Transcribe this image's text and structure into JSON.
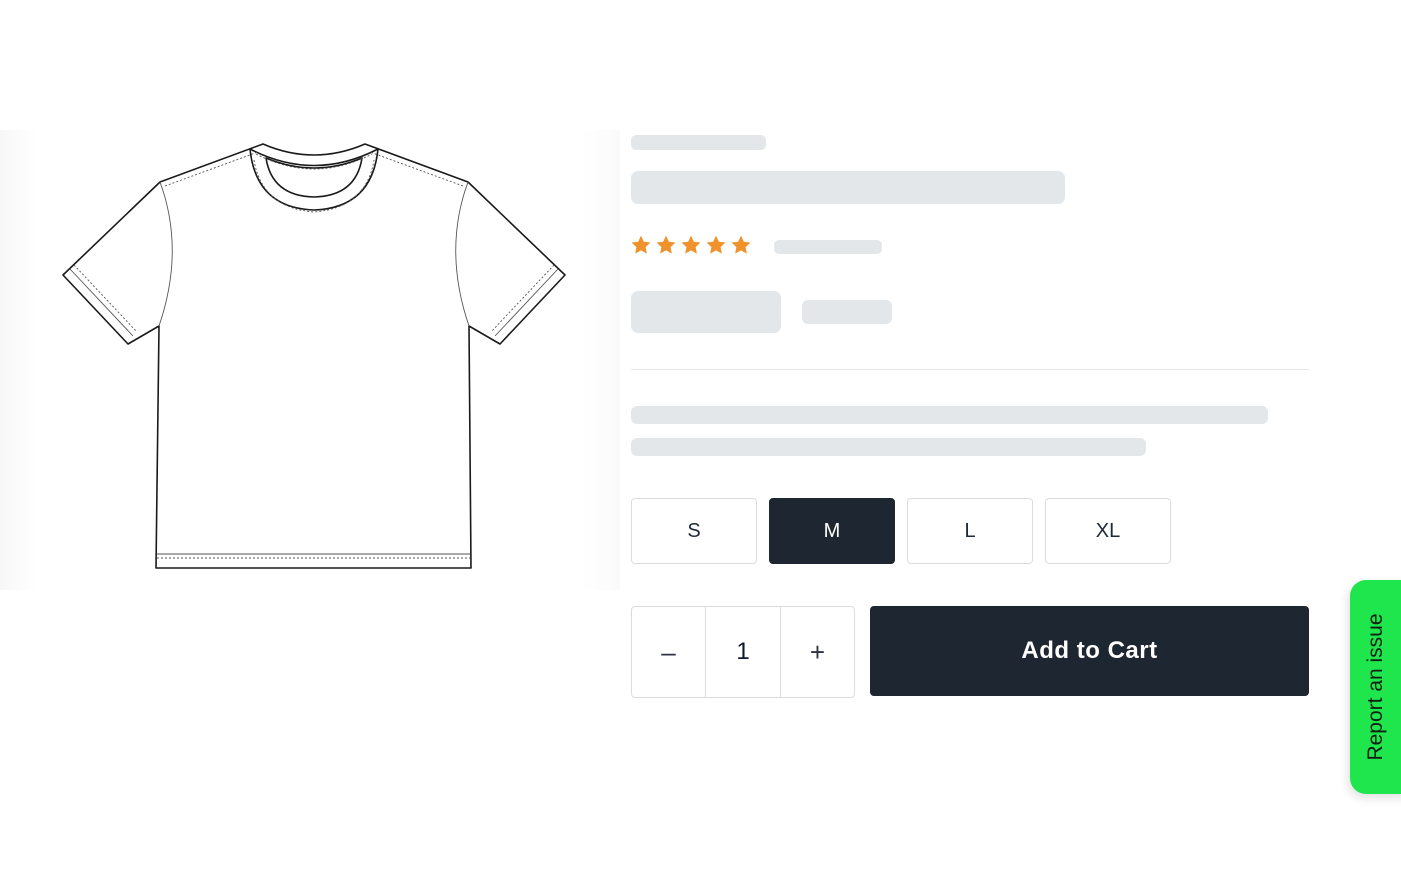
{
  "product": {
    "image_icon": "t-shirt-illustration",
    "rating": 5,
    "rating_max": 5,
    "star_color": "#f0922b"
  },
  "sizes": {
    "options": [
      "S",
      "M",
      "L",
      "XL"
    ],
    "selected": "M"
  },
  "quantity": {
    "decrement_label": "–",
    "value": "1",
    "increment_label": "+"
  },
  "cart": {
    "add_label": "Add to Cart"
  },
  "report": {
    "label": "Report an issue",
    "color": "#1fe64c"
  },
  "theme": {
    "dark": "#1e2631",
    "skeleton": "#e4e7ea"
  }
}
